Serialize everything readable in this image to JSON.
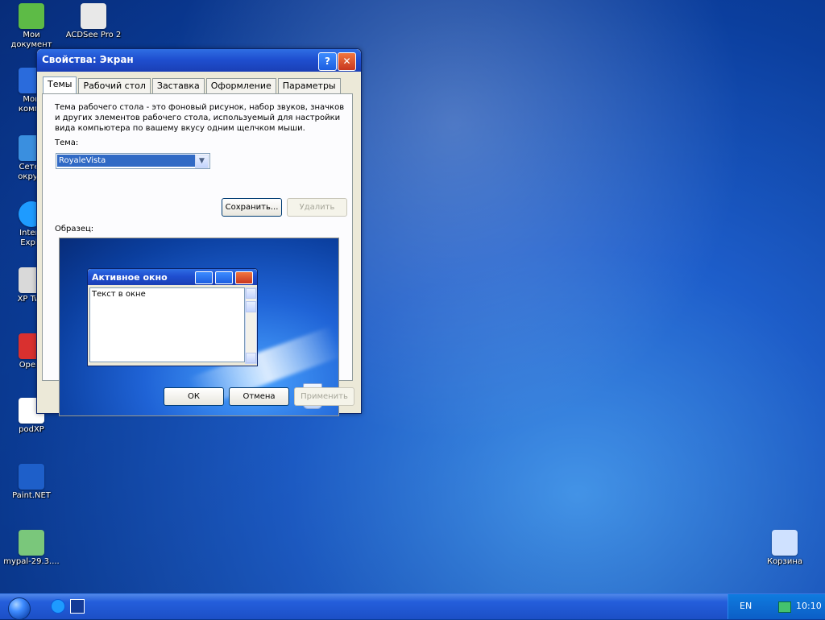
{
  "desktop": {
    "icons": [
      {
        "label": "Мои\nдокумент",
        "icon": "my-documents-icon"
      },
      {
        "label": "ACDSee Pro 2",
        "icon": "acdsee-icon"
      },
      {
        "label": "Мой\nкомпь",
        "icon": "my-computer-icon"
      },
      {
        "label": "Сетев\nокруж",
        "icon": "network-icon"
      },
      {
        "label": "Intern\nExplo",
        "icon": "ie-icon"
      },
      {
        "label": "XP Twe",
        "icon": "xp-tweaker-icon"
      },
      {
        "label": "Opera",
        "icon": "opera-icon"
      },
      {
        "label": "podXP",
        "icon": "document-icon"
      },
      {
        "label": "Paint.NET",
        "icon": "paintnet-icon"
      },
      {
        "label": "mypal-29.3....",
        "icon": "installer-icon"
      },
      {
        "label": "Корзина",
        "icon": "recycle-bin-icon"
      }
    ]
  },
  "window": {
    "title": "Свойства: Экран",
    "tabs": [
      {
        "label": "Темы",
        "active": true
      },
      {
        "label": "Рабочий стол",
        "active": false
      },
      {
        "label": "Заставка",
        "active": false
      },
      {
        "label": "Оформление",
        "active": false
      },
      {
        "label": "Параметры",
        "active": false
      }
    ],
    "description": "Тема рабочего стола - это фоновый рисунок, набор звуков, значков и других элементов рабочего стола, используемый для настройки вида компьютера по вашему вкусу одним щелчком мыши.",
    "theme_label": "Тема:",
    "theme_value": "RoyaleVista",
    "save_button": "Сохранить...",
    "delete_button": "Удалить",
    "preview_label": "Образец:",
    "preview": {
      "window_title": "Активное окно",
      "window_text": "Текст в окне"
    },
    "footer": {
      "ok": "ОК",
      "cancel": "Отмена",
      "apply": "Применить"
    }
  },
  "taskbar": {
    "lang": "EN",
    "time": "10:10"
  }
}
